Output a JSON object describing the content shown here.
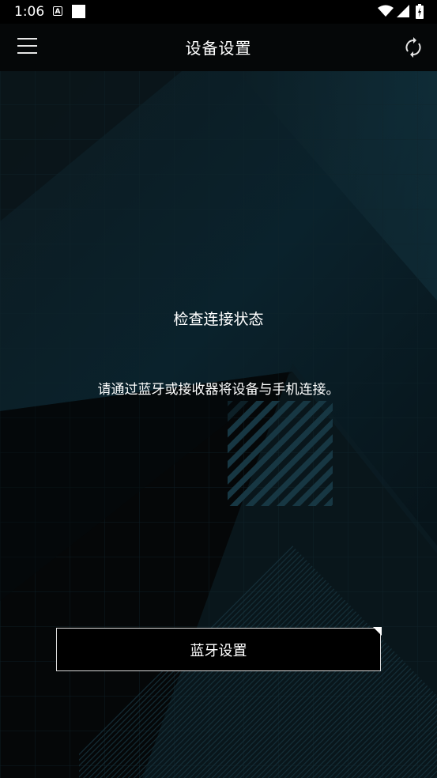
{
  "status_bar": {
    "time": "1:06",
    "notification_icon_letter": "A",
    "icons": [
      "wifi-icon",
      "signal-icon",
      "battery-icon"
    ]
  },
  "app_bar": {
    "title": "设备设置",
    "menu_icon": "menu-icon",
    "refresh_icon": "refresh-icon"
  },
  "main": {
    "heading": "检查连接状态",
    "description": "请通过蓝牙或接收器将设备与手机连接。",
    "bluetooth_button_label": "蓝牙设置"
  },
  "colors": {
    "background": "#050708",
    "accent_teal": "#0f2a33",
    "text": "#ffffff",
    "button_border": "#d9d9d9"
  }
}
